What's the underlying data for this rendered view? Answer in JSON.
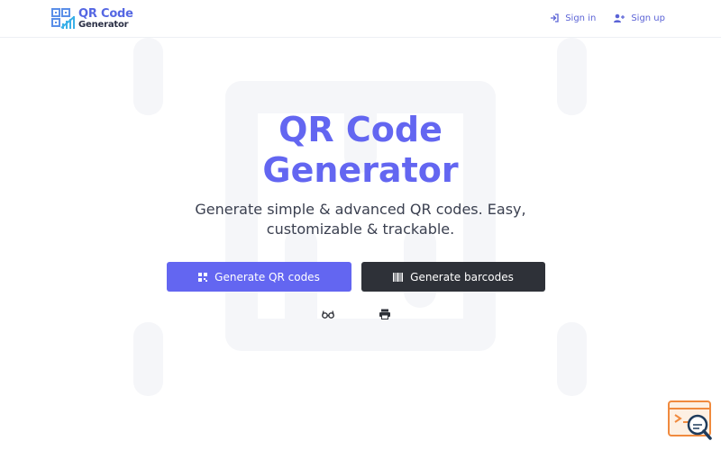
{
  "header": {
    "logo_line1": "QR Code",
    "logo_line2": "Generator",
    "sign_in": "Sign in",
    "sign_up": "Sign up"
  },
  "hero": {
    "title_line1": "QR Code",
    "title_line2": "Generator",
    "subtitle": "Generate simple & advanced QR codes. Easy, customizable & trackable."
  },
  "actions": {
    "generate_qr": "Generate QR codes",
    "generate_barcodes": "Generate barcodes"
  },
  "icons": {
    "logo": "qr-code-logo-icon",
    "sign_in": "sign-in-icon",
    "sign_up": "user-plus-icon",
    "qr": "qr-code-icon",
    "barcode": "barcode-icon",
    "glasses": "glasses-icon",
    "print": "printer-icon",
    "widget": "code-search-widget-icon"
  },
  "colors": {
    "accent": "#6366f1",
    "dark_button": "#2e3138",
    "text": "#3b4050",
    "link": "#5b63d6"
  }
}
